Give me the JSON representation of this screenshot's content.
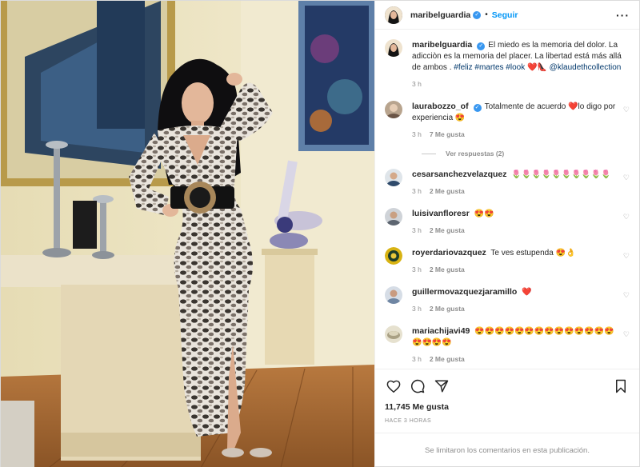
{
  "post": {
    "author": "maribelguardia",
    "follow_label": "Seguir",
    "dot": "•",
    "more_label": "···",
    "caption_prefix": "El miedo es la memoria del dolor. La adicciòn es la memoria del placer. La libertad está más allá de ambos . ",
    "caption_tags": "#feliz #martes #look",
    "caption_emoji": "❤️👠",
    "caption_mention": "@klaudethcollection",
    "caption_time": "3 h",
    "likes": "11,745 Me gusta",
    "posted_ago": "HACE 3 HORAS",
    "comments_limited": "Se limitaron los comentarios en esta publicación."
  },
  "comments": [
    {
      "user": "laurabozzo_of",
      "verified": true,
      "text": "Totalmente de acuerdo ❤️lo digo por experiencia 😍",
      "time": "3 h",
      "likes": "7 Me gusta",
      "avatar_color": "#b8a48e"
    },
    {
      "user": "cesarsanchezvelazquez",
      "verified": false,
      "text": "🌷🌷🌷🌷🌷🌷🌷🌷🌷🌷",
      "time": "3 h",
      "likes": "2 Me gusta",
      "avatar_color": "#4a6b8a"
    },
    {
      "user": "luisivanfloresr",
      "verified": false,
      "text": "😍😍",
      "time": "3 h",
      "likes": "2 Me gusta",
      "avatar_color": "#8a8f96"
    },
    {
      "user": "royerdariovazquez",
      "verified": false,
      "text": "Te ves estupenda 😍👌",
      "time": "3 h",
      "likes": "2 Me gusta",
      "avatar_color": "#d8b313"
    },
    {
      "user": "guillermovazquezjaramillo",
      "verified": false,
      "text": "❤️",
      "time": "3 h",
      "likes": "2 Me gusta",
      "avatar_color": "#7b8fa6"
    },
    {
      "user": "mariachijavi49",
      "verified": false,
      "text": "😍😍😍😍😍😍😍😍😍😍😍😍😍😍😍😍😍😍",
      "time": "3 h",
      "likes": "2 Me gusta",
      "avatar_color": "#c9c2a6"
    }
  ],
  "replies_label": "Ver respuestas (2)",
  "colors": {
    "link": "#0095f6",
    "verified": "#3897f0",
    "muted": "#8e8e8e"
  },
  "icons": [
    "heart-icon",
    "comment-icon",
    "share-icon",
    "bookmark-icon",
    "more-icon",
    "verified-badge-icon"
  ]
}
